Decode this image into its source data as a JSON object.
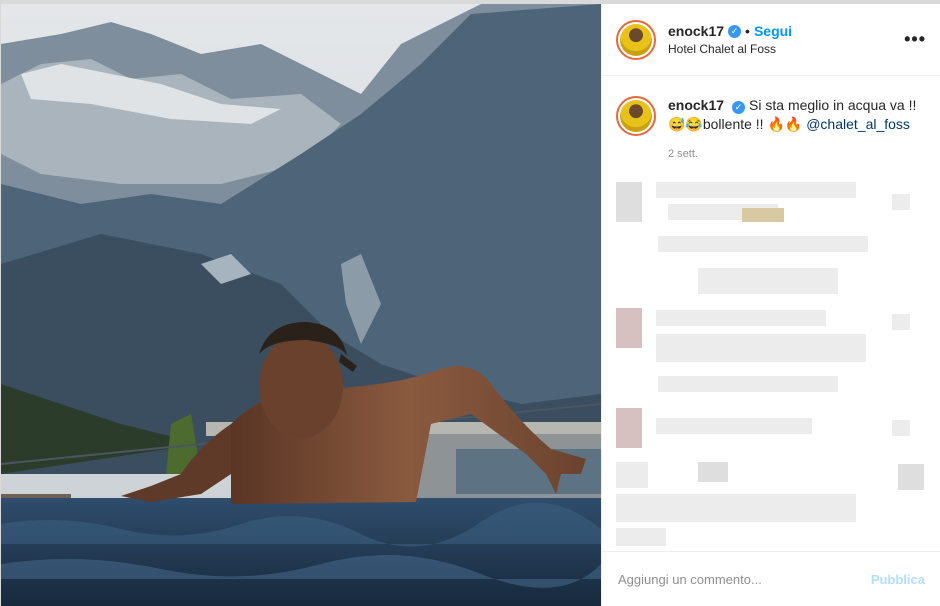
{
  "post": {
    "username": "enock17",
    "follow_label": "Segui",
    "separator": "•",
    "location": "Hotel Chalet al Foss",
    "more_icon": "•••",
    "verified_icon": "✓"
  },
  "caption": {
    "username": "enock17",
    "text_part1": "Si sta meglio in acqua va !! 😅😂bollente !! 🔥🔥 ",
    "mention": "@chalet_al_foss",
    "time": "2 sett."
  },
  "comment_box": {
    "placeholder": "Aggiungi un commento...",
    "publish_label": "Pubblica"
  }
}
